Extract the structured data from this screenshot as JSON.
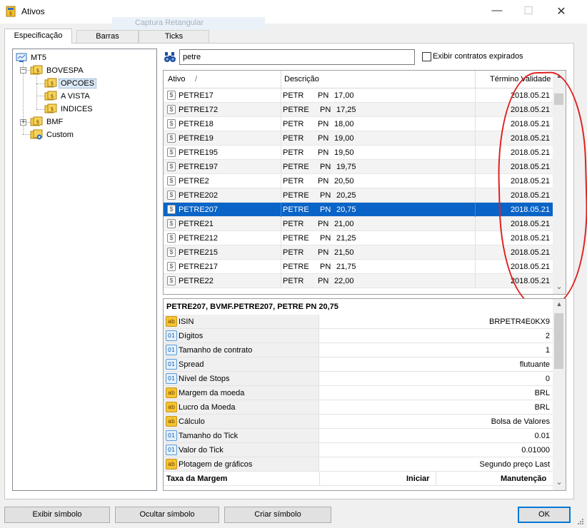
{
  "window": {
    "title": "Ativos",
    "ghost_tooltip": "Captura Retangular",
    "minimize": "—",
    "maximize": "☐",
    "close": "✕"
  },
  "tabs": [
    {
      "label": "Especificação",
      "active": true
    },
    {
      "label": "Barras",
      "active": false
    },
    {
      "label": "Ticks",
      "active": false
    }
  ],
  "tree": {
    "root": "MT5",
    "bovespa": "BOVESPA",
    "opcoes": "OPCOES",
    "a_vista": "A VISTA",
    "indices": "INDICES",
    "bmf": "BMF",
    "custom": "Custom",
    "expand_minus": "−",
    "expand_plus": "+"
  },
  "search": {
    "value": "petre",
    "expired_label": "Exibir contratos expirados",
    "expired_checked": false
  },
  "grid": {
    "columns": {
      "ativo": "Ativo",
      "sort": "/",
      "descricao": "Descrição",
      "termino": "Término Validade"
    },
    "rows": [
      {
        "ativo": "PETRE17",
        "desc1": "PETR",
        "desc2": "PN",
        "desc3": "17,00",
        "termino": "2018.05.21"
      },
      {
        "ativo": "PETRE172",
        "desc1": "PETRE",
        "desc2": "PN",
        "desc3": "17,25",
        "termino": "2018.05.21"
      },
      {
        "ativo": "PETRE18",
        "desc1": "PETR",
        "desc2": "PN",
        "desc3": "18,00",
        "termino": "2018.05.21"
      },
      {
        "ativo": "PETRE19",
        "desc1": "PETR",
        "desc2": "PN",
        "desc3": "19,00",
        "termino": "2018.05.21"
      },
      {
        "ativo": "PETRE195",
        "desc1": "PETR",
        "desc2": "PN",
        "desc3": "19,50",
        "termino": "2018.05.21"
      },
      {
        "ativo": "PETRE197",
        "desc1": "PETRE",
        "desc2": "PN",
        "desc3": "19,75",
        "termino": "2018.05.21"
      },
      {
        "ativo": "PETRE2",
        "desc1": "PETR",
        "desc2": "PN",
        "desc3": "20,50",
        "termino": "2018.05.21"
      },
      {
        "ativo": "PETRE202",
        "desc1": "PETRE",
        "desc2": "PN",
        "desc3": "20,25",
        "termino": "2018.05.21"
      },
      {
        "ativo": "PETRE207",
        "desc1": "PETRE",
        "desc2": "PN",
        "desc3": "20,75",
        "termino": "2018.05.21",
        "selected": true
      },
      {
        "ativo": "PETRE21",
        "desc1": "PETR",
        "desc2": "PN",
        "desc3": "21,00",
        "termino": "2018.05.21"
      },
      {
        "ativo": "PETRE212",
        "desc1": "PETRE",
        "desc2": "PN",
        "desc3": "21,25",
        "termino": "2018.05.21"
      },
      {
        "ativo": "PETRE215",
        "desc1": "PETR",
        "desc2": "PN",
        "desc3": "21,50",
        "termino": "2018.05.21"
      },
      {
        "ativo": "PETRE217",
        "desc1": "PETRE",
        "desc2": "PN",
        "desc3": "21,75",
        "termino": "2018.05.21"
      },
      {
        "ativo": "PETRE22",
        "desc1": "PETR",
        "desc2": "PN",
        "desc3": "22,00",
        "termino": "2018.05.21"
      }
    ],
    "scroll_up": "▲",
    "scroll_down": "⌄"
  },
  "details": {
    "title": "PETRE207, BVMF.PETRE207, PETRE     PN  20,75",
    "properties": [
      {
        "type": "ab",
        "key": "ISIN",
        "value": "BRPETR4E0KX9"
      },
      {
        "type": "01",
        "key": "Dígitos",
        "value": "2"
      },
      {
        "type": "01",
        "key": "Tamanho de contrato",
        "value": "1"
      },
      {
        "type": "01",
        "key": "Spread",
        "value": "flutuante"
      },
      {
        "type": "01",
        "key": "Nível de Stops",
        "value": "0"
      },
      {
        "type": "ab",
        "key": "Margem da moeda",
        "value": "BRL"
      },
      {
        "type": "ab",
        "key": "Lucro da Moeda",
        "value": "BRL"
      },
      {
        "type": "ab",
        "key": "Cálculo",
        "value": "Bolsa de Valores"
      },
      {
        "type": "01",
        "key": "Tamanho do Tick",
        "value": "0.01"
      },
      {
        "type": "01",
        "key": "Valor do Tick",
        "value": "0.01000"
      },
      {
        "type": "ab",
        "key": "Plotagem de gráficos",
        "value": "Segundo preço Last"
      }
    ],
    "margin_table": {
      "label": "Taxa da Margem",
      "col_iniciar": "Iniciar",
      "col_manutencao": "Manutenção"
    }
  },
  "buttons": {
    "show_symbol": "Exibir símbolo",
    "hide_symbol": "Ocultar símbolo",
    "create_symbol": "Criar símbolo",
    "ok": "OK"
  },
  "colors": {
    "selection": "#0a64c7",
    "annotation": "#e02020",
    "ok_border": "#0078d7"
  }
}
